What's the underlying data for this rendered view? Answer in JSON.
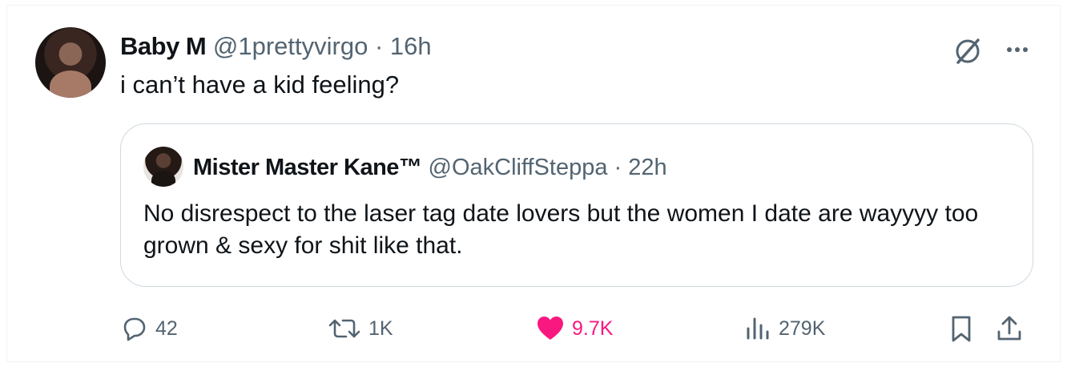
{
  "tweet": {
    "author_name": "Baby M",
    "author_handle": "@1prettyvirgo",
    "separator": "·",
    "time": "16h",
    "text": "i can’t have a kid feeling?"
  },
  "quoted_tweet": {
    "author_name": "Mister Master Kane™",
    "author_handle": "@OakCliffSteppa",
    "separator": "·",
    "time": "22h",
    "text": "No disrespect to the laser tag date lovers but the women I date are wayyyy too grown & sexy for shit like that."
  },
  "actions": {
    "replies": "42",
    "reposts": "1K",
    "likes": "9.7K",
    "views": "279K"
  },
  "colors": {
    "text": "#0f1419",
    "secondary": "#536471",
    "like": "#f91880",
    "border": "#cfd9de"
  },
  "icons": [
    "grok-icon",
    "more-icon",
    "reply-icon",
    "repost-icon",
    "like-icon",
    "views-icon",
    "bookmark-icon",
    "share-icon"
  ]
}
